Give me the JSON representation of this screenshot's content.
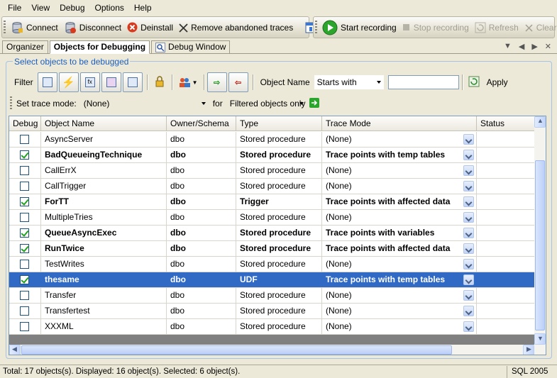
{
  "menu": [
    "File",
    "View",
    "Debug",
    "Options",
    "Help"
  ],
  "toolbar1": {
    "connect": "Connect",
    "disconnect": "Disconnect",
    "deinstall": "Deinstall",
    "remove_abandoned": "Remove abandoned traces"
  },
  "toolbar2": {
    "start_recording": "Start recording",
    "stop_recording": "Stop recording",
    "refresh": "Refresh",
    "clear": "Clear"
  },
  "tabs": [
    "Organizer",
    "Objects for Debugging",
    "Debug Window"
  ],
  "active_tab": "Objects for Debugging",
  "group_title": "Select objects to be debugged",
  "filter": {
    "label": "Filter",
    "object_name_label": "Object Name",
    "match_mode": "Starts with",
    "value": "",
    "apply": "Apply"
  },
  "trace": {
    "label": "Set trace mode:",
    "mode": "(None)",
    "for_label": "for",
    "scope": "Filtered objects only"
  },
  "grid": {
    "columns": [
      "Debug",
      "Object Name",
      "Owner/Schema",
      "Type",
      "Trace Mode",
      "Status"
    ],
    "rows": [
      {
        "debug": false,
        "name": "AsyncServer",
        "owner": "dbo",
        "type": "Stored procedure",
        "trace": "(None)",
        "status": "",
        "bold": false,
        "selected": false
      },
      {
        "debug": true,
        "name": "BadQueueingTechnique",
        "owner": "dbo",
        "type": "Stored procedure",
        "trace": "Trace points with temp tables",
        "status": "",
        "bold": true,
        "selected": false
      },
      {
        "debug": false,
        "name": "CallErrX",
        "owner": "dbo",
        "type": "Stored procedure",
        "trace": "(None)",
        "status": "",
        "bold": false,
        "selected": false
      },
      {
        "debug": false,
        "name": "CallTrigger",
        "owner": "dbo",
        "type": "Stored procedure",
        "trace": "(None)",
        "status": "",
        "bold": false,
        "selected": false
      },
      {
        "debug": true,
        "name": "ForTT",
        "owner": "dbo",
        "type": "Trigger",
        "trace": "Trace points with affected data",
        "status": "",
        "bold": true,
        "selected": false
      },
      {
        "debug": false,
        "name": "MultipleTries",
        "owner": "dbo",
        "type": "Stored procedure",
        "trace": "(None)",
        "status": "",
        "bold": false,
        "selected": false
      },
      {
        "debug": true,
        "name": "QueueAsyncExec",
        "owner": "dbo",
        "type": "Stored procedure",
        "trace": "Trace points with variables",
        "status": "",
        "bold": true,
        "selected": false
      },
      {
        "debug": true,
        "name": "RunTwice",
        "owner": "dbo",
        "type": "Stored procedure",
        "trace": "Trace points with affected data",
        "status": "",
        "bold": true,
        "selected": false
      },
      {
        "debug": false,
        "name": "TestWrites",
        "owner": "dbo",
        "type": "Stored procedure",
        "trace": "(None)",
        "status": "",
        "bold": false,
        "selected": false
      },
      {
        "debug": true,
        "name": "thesame",
        "owner": "dbo",
        "type": "UDF",
        "trace": "Trace points with temp tables",
        "status": "",
        "bold": true,
        "selected": true
      },
      {
        "debug": false,
        "name": "Transfer",
        "owner": "dbo",
        "type": "Stored procedure",
        "trace": "(None)",
        "status": "",
        "bold": false,
        "selected": false
      },
      {
        "debug": false,
        "name": "Transfertest",
        "owner": "dbo",
        "type": "Stored procedure",
        "trace": "(None)",
        "status": "",
        "bold": false,
        "selected": false
      },
      {
        "debug": false,
        "name": "XXXML",
        "owner": "dbo",
        "type": "Stored procedure",
        "trace": "(None)",
        "status": "",
        "bold": false,
        "selected": false
      }
    ]
  },
  "status": {
    "summary": "Total: 17 objects(s). Displayed: 16 object(s). Selected: 6 object(s).",
    "server": "SQL 2005"
  },
  "colors": {
    "selection": "#316ac5",
    "group_title": "#1b5fc2",
    "record_green": "#2ca52c",
    "deinstall_red": "#d83a1e"
  }
}
